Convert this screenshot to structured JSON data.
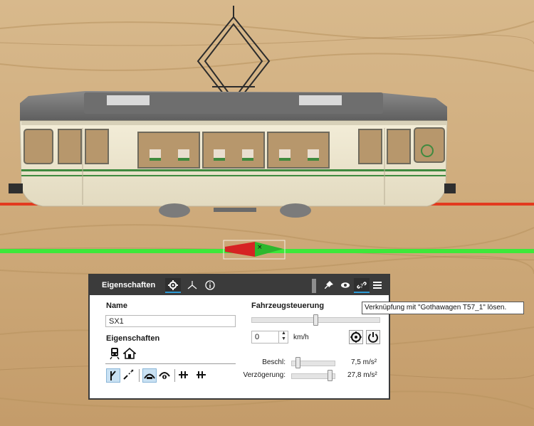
{
  "colors": {
    "floor": "#cda778",
    "rail_red": "#e33a1f",
    "rail_green": "#3ee83a",
    "tram_body": "#efe8d0",
    "tram_roof": "#767676",
    "tram_stripe": "#3f8a3f",
    "panel_header": "#3b3b3b",
    "accent": "#2e9bd6"
  },
  "panel": {
    "title": "Eigenschaften",
    "header_icons": [
      "gear-icon",
      "axis-icon",
      "info-icon",
      "pin-icon",
      "eye-icon",
      "unlink-icon",
      "menu-icon"
    ],
    "name_label": "Name",
    "name_value": "SX1",
    "properties_label": "Eigenschaften",
    "property_icons": [
      "tram-vehicle-icon",
      "home-icon"
    ],
    "toolbar_icons": [
      "track-switch-icon",
      "track-path-icon",
      "sound-a-icon",
      "sound-b-icon",
      "couple-front-icon",
      "couple-rear-icon"
    ],
    "toolbar_active": [
      "track-switch-icon",
      "sound-a-icon"
    ],
    "control_label": "Fahrzeugsteuerung",
    "speed_slider_level": 0.5,
    "speed_value": "0",
    "speed_unit": "km/h",
    "accel_label": "Beschl:",
    "accel_value": "7,5 m/s²",
    "accel_level": 0.1,
    "decel_label": "Verzögerung:",
    "decel_value": "27,8 m/s²",
    "decel_level": 0.93
  },
  "tooltip": {
    "text": "Verknüpfung mit \"Gothawagen T57_1\" lösen."
  }
}
